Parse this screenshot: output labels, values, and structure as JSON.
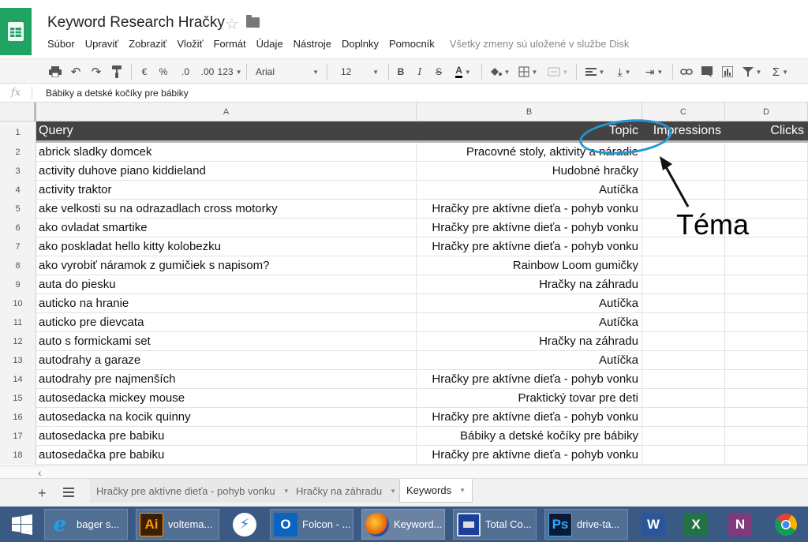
{
  "document": {
    "title": "Keyword Research Hračky",
    "icons": {
      "star": "star-outline-icon",
      "folder": "folder-icon",
      "logo": "sheets-logo-icon"
    }
  },
  "menu": {
    "items": [
      "Súbor",
      "Upraviť",
      "Zobraziť",
      "Vložiť",
      "Formát",
      "Údaje",
      "Nástroje",
      "Doplnky",
      "Pomocník"
    ],
    "save_status": "Všetky zmeny sú uložené v službe Disk"
  },
  "toolbar": {
    "currency": "€",
    "percent": "%",
    "decrease_decimals": ".0",
    "increase_decimals": ".00",
    "more_formats": "123",
    "font": "Arial",
    "font_size": "12",
    "bold": "B",
    "italic": "I",
    "strikethrough": "S",
    "text_color": "A",
    "sum": "Σ"
  },
  "formula_bar": {
    "fx_label": "fx",
    "value": "Bábiky a detské kočíky pre bábiky"
  },
  "columns": [
    "A",
    "B",
    "C",
    "D"
  ],
  "header_row": {
    "number": "1",
    "query": "Query",
    "topic": "Topic",
    "impressions": "Impressions",
    "clicks": "Clicks"
  },
  "rows": [
    {
      "n": "2",
      "query": "abrick sladky domcek",
      "topic": "Pracovné stoly, aktivity a náradie"
    },
    {
      "n": "3",
      "query": "activity duhove piano kiddieland",
      "topic": "Hudobné hračky"
    },
    {
      "n": "4",
      "query": "activity traktor",
      "topic": "Autíčka"
    },
    {
      "n": "5",
      "query": "ake velkosti su na odrazadlach cross motorky",
      "topic": "Hračky pre aktívne dieťa - pohyb vonku"
    },
    {
      "n": "6",
      "query": "ako ovladat smartike",
      "topic": "Hračky pre aktívne dieťa - pohyb vonku"
    },
    {
      "n": "7",
      "query": "ako poskladat hello kitty kolobezku",
      "topic": "Hračky pre aktívne dieťa - pohyb vonku"
    },
    {
      "n": "8",
      "query": "ako vyrobiť náramok z gumičiek s napisom?",
      "topic": "Rainbow Loom gumičky"
    },
    {
      "n": "9",
      "query": "auta do piesku",
      "topic": "Hračky na záhradu"
    },
    {
      "n": "10",
      "query": "auticko na hranie",
      "topic": "Autíčka"
    },
    {
      "n": "11",
      "query": "auticko pre dievcata",
      "topic": "Autíčka"
    },
    {
      "n": "12",
      "query": "auto s formickami set",
      "topic": "Hračky na záhradu"
    },
    {
      "n": "13",
      "query": "autodrahy a garaze",
      "topic": "Autíčka"
    },
    {
      "n": "14",
      "query": "autodrahy pre najmenších",
      "topic": "Hračky pre aktívne dieťa - pohyb vonku"
    },
    {
      "n": "15",
      "query": "autosedacka mickey mouse",
      "topic": "Praktický tovar pre deti"
    },
    {
      "n": "16",
      "query": "autosedacka na kocik quinny",
      "topic": "Hračky pre aktívne dieťa - pohyb vonku"
    },
    {
      "n": "17",
      "query": "autosedacka pre babiku",
      "topic": "Bábiky a detské kočíky pre bábiky"
    },
    {
      "n": "18",
      "query": "autosedačka pre babiku",
      "topic": "Hračky pre aktívne dieťa - pohyb vonku"
    }
  ],
  "sheet_tabs": [
    {
      "label": "Hračky pre aktívne dieťa - pohyb vonku",
      "active": false
    },
    {
      "label": "Hračky na záhradu",
      "active": false
    },
    {
      "label": "Keywords",
      "active": true
    }
  ],
  "annotation": {
    "label": "Téma",
    "color": "#2596d4"
  },
  "taskbar": {
    "items": [
      {
        "label": "",
        "icon": "windows-start-icon"
      },
      {
        "label": "bager s...",
        "icon": "internet-explorer-icon"
      },
      {
        "label": "voltema...",
        "icon": "illustrator-icon",
        "glyph": "Ai"
      },
      {
        "label": "",
        "icon": "lightning-app-icon"
      },
      {
        "label": "Folcon - ...",
        "icon": "outlook-icon",
        "glyph": "O"
      },
      {
        "label": "Keyword...",
        "icon": "firefox-icon"
      },
      {
        "label": "Total Co...",
        "icon": "floppy-disk-icon"
      },
      {
        "label": "drive-ta...",
        "icon": "photoshop-icon",
        "glyph": "Ps"
      },
      {
        "label": "",
        "icon": "word-icon",
        "glyph": "W"
      },
      {
        "label": "",
        "icon": "excel-icon",
        "glyph": "X"
      },
      {
        "label": "",
        "icon": "onenote-icon",
        "glyph": "N"
      },
      {
        "label": "",
        "icon": "chrome-icon"
      }
    ]
  }
}
